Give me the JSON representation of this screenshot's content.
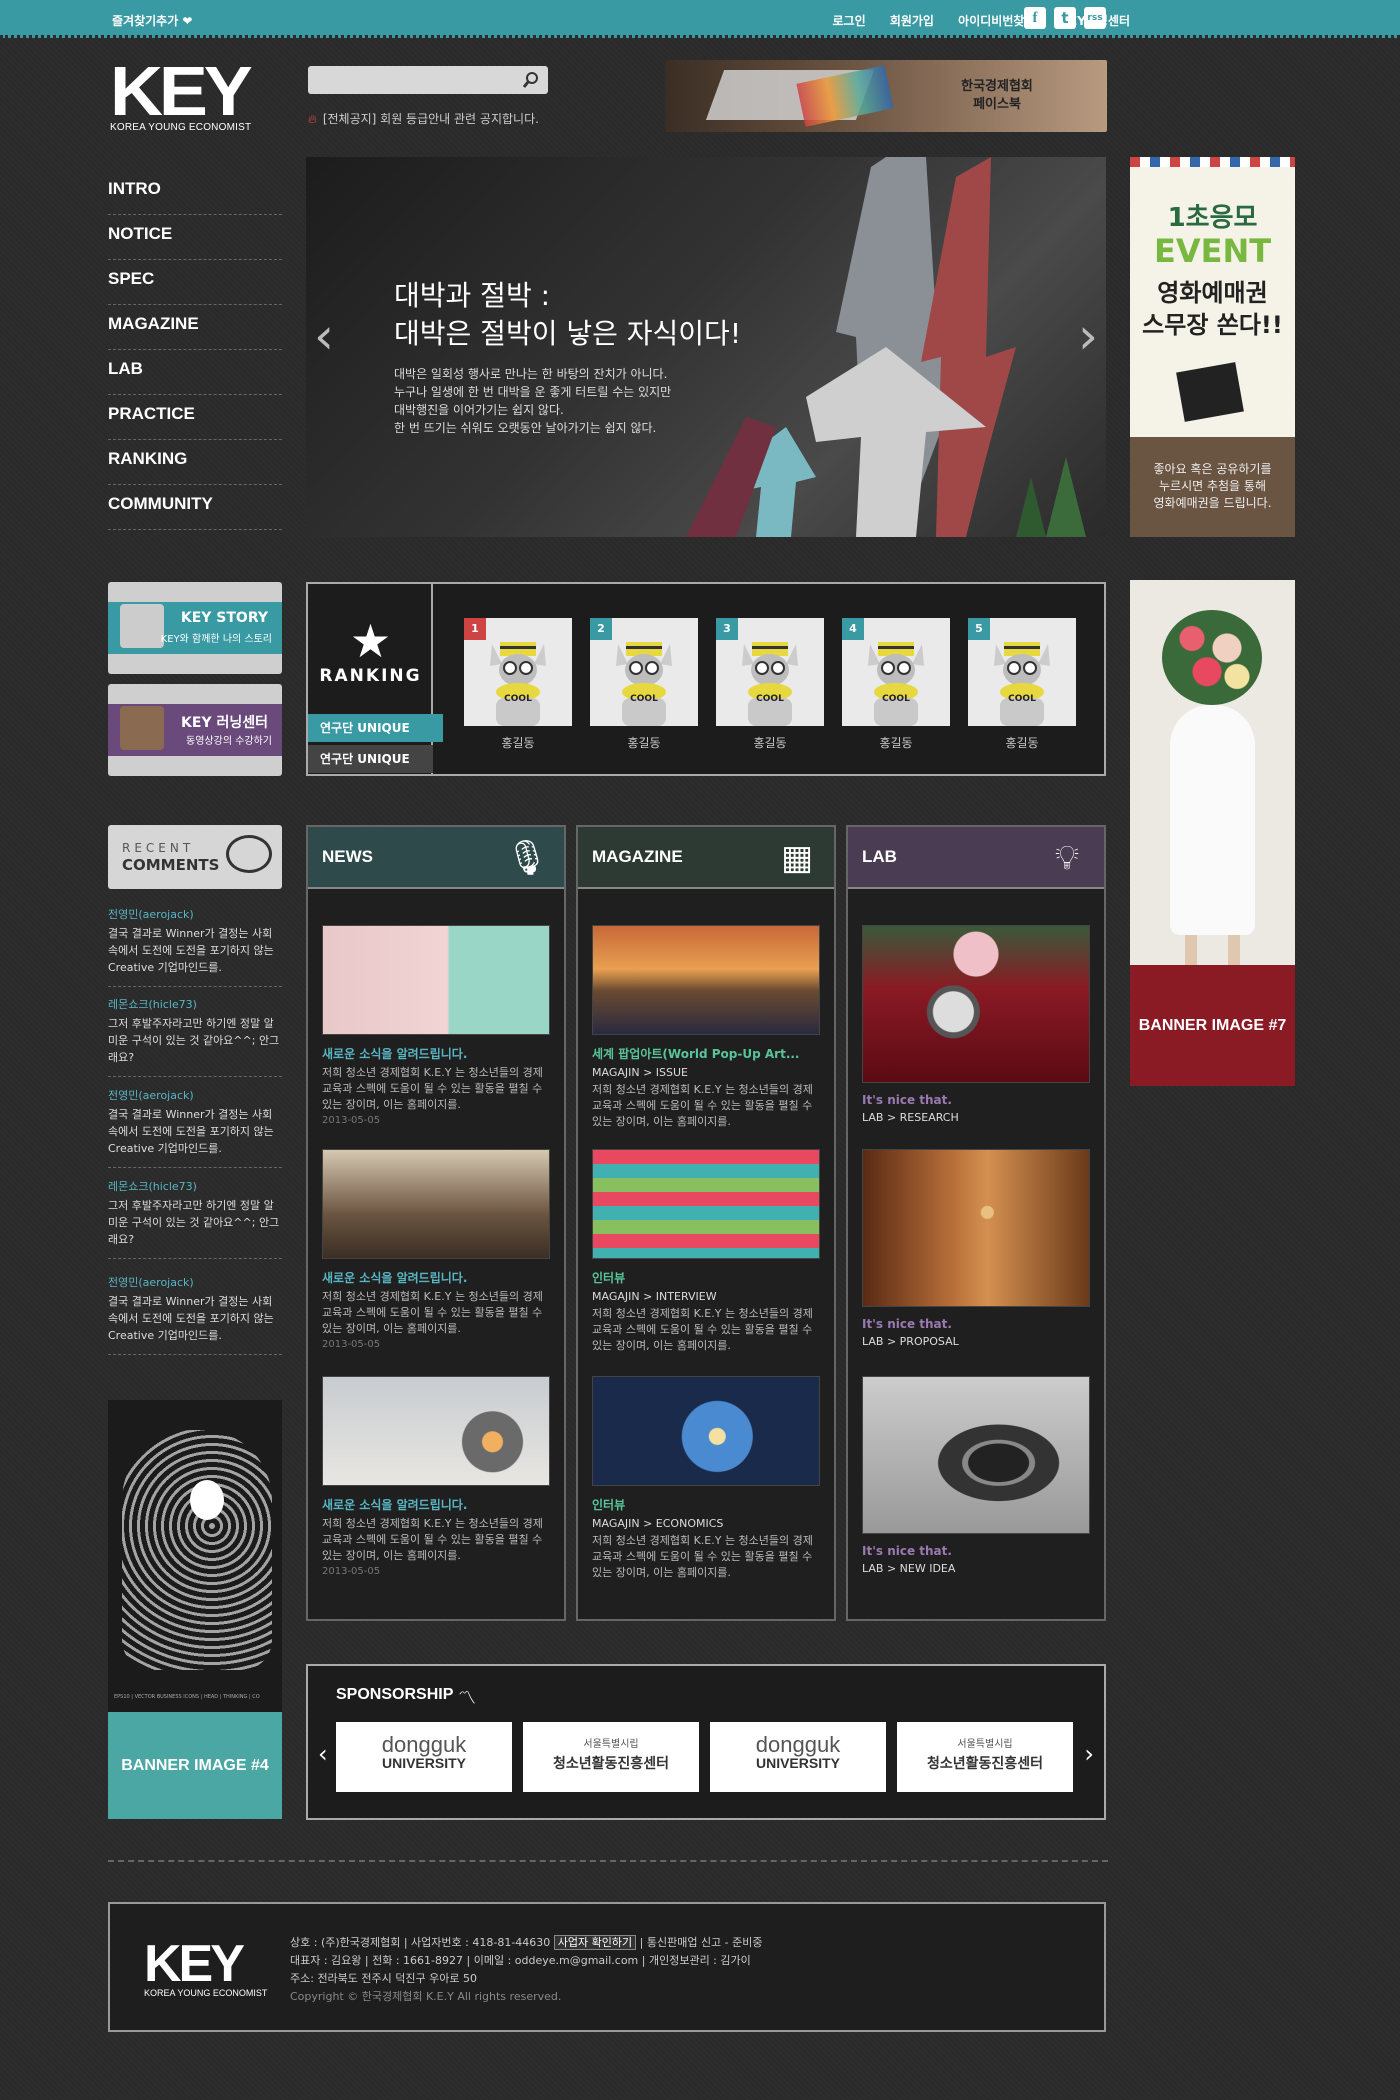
{
  "topbar": {
    "bookmark": "즐겨찾기추가 ❤",
    "links": [
      "로그인",
      "회원가입",
      "아이디비번찾기",
      "KEY러닝센터"
    ],
    "social": [
      "f",
      "t",
      "rss"
    ]
  },
  "brand": {
    "logo": "KEY",
    "tagline": "KOREA YOUNG ECONOMIST"
  },
  "search": {
    "placeholder": ""
  },
  "notice": {
    "text": "[전체공지] 회원 등급안내 관련 공지합니다."
  },
  "fb_banner": {
    "line1": "한국경제협회",
    "line2": "페이스북"
  },
  "nav": [
    "INTRO",
    "NOTICE",
    "SPEC",
    "MAGAZINE",
    "LAB",
    "PRACTICE",
    "RANKING",
    "COMMUNITY"
  ],
  "hero": {
    "title1": "대박과 절박 :",
    "title2": "대박은 절박이 낳은 자식이다!",
    "body": [
      "대박은 일회성 행사로 만나는 한 바탕의 잔치가 아니다.",
      "누구나 일생에 한 번 대박을 운 좋게 터트릴 수는 있지만",
      "대박행진을 이어가기는 쉽지 않다.",
      "한 번 뜨기는 쉬워도 오랫동안 날아가기는 쉽지 않다."
    ],
    "prev": "‹",
    "next": "›"
  },
  "event_banner": {
    "line1": "1초응모",
    "line2": "EVENT",
    "line3": "영화예매권",
    "line4": "스무장 쏜다!!",
    "bottom1": "좋아요 혹은 공유하기를",
    "bottom2": "누르시면 추첨을 통해",
    "bottom3": "영화예매권을 드립니다."
  },
  "key_story": {
    "title": "KEY STORY",
    "sub": "KEY와 함께한 나의 스토리"
  },
  "key_learning": {
    "title": "KEY 러닝센터",
    "sub": "동영상강의 수강하기"
  },
  "ranking": {
    "label": "RANKING",
    "tabs": [
      "연구단 UNIQUE",
      "연구단 UNIQUE"
    ],
    "items": [
      {
        "num": "1",
        "name": "홍길동",
        "badge": "COOL"
      },
      {
        "num": "2",
        "name": "홍길동",
        "badge": "COOL"
      },
      {
        "num": "3",
        "name": "홍길동",
        "badge": "COOL"
      },
      {
        "num": "4",
        "name": "홍길동",
        "badge": "COOL"
      },
      {
        "num": "5",
        "name": "홍길동",
        "badge": "COOL"
      }
    ]
  },
  "recent": {
    "label1": "RECENT",
    "label2": "COMMENTS",
    "items": [
      {
        "who": "전영민(aerojack)",
        "body": "결국 결과로 Winner가 결정는 사회속에서 도전에 도전을 포기하지 않는 Creative 기업마인드를."
      },
      {
        "who": "레몬쇼크(hicle73)",
        "body": "그저 후발주자라고만 하기엔 정말 알 미운 구석이 있는 것 같아요^^; 안그래요?"
      },
      {
        "who": "전영민(aerojack)",
        "body": "결국 결과로 Winner가 결정는 사회속에서 도전에 도전을 포기하지 않는 Creative 기업마인드를."
      },
      {
        "who": "레몬쇼크(hicle73)",
        "body": "그저 후발주자라고만 하기엔 정말 알 미운 구석이 있는 것 같아요^^; 안그래요?"
      },
      {
        "who": "전영민(aerojack)",
        "body": "결국 결과로 Winner가 결정는 사회속에서 도전에 도전을 포기하지 않는 Creative 기업마인드를."
      }
    ]
  },
  "bulb_caption": "EPS10 | VECTOR BUSINESS ICONS | HEAD | THINKING | CO",
  "banner4": "BANNER IMAGE #4",
  "banner7": "BANNER IMAGE #7",
  "news": {
    "title": "NEWS",
    "items": [
      {
        "title": "새로운 소식을 알려드립니다.",
        "desc": "저희 청소년 경제협회 K.E.Y 는 청소년들의 경제교육과 스펙에 도움이 될 수 있는 활동을 펼칠 수 있는 장이며, 이는 홈페이지를.",
        "date": "2013-05-05"
      },
      {
        "title": "새로운 소식을 알려드립니다.",
        "desc": "저희 청소년 경제협회 K.E.Y 는 청소년들의 경제교육과 스펙에 도움이 될 수 있는 활동을 펼칠 수 있는 장이며, 이는 홈페이지를.",
        "date": "2013-05-05"
      },
      {
        "title": "새로운 소식을 알려드립니다.",
        "desc": "저희 청소년 경제협회 K.E.Y 는 청소년들의 경제교육과 스펙에 도움이 될 수 있는 활동을 펼칠 수 있는 장이며, 이는 홈페이지를.",
        "date": "2013-05-05"
      }
    ]
  },
  "magazine": {
    "title": "MAGAZINE",
    "items": [
      {
        "title": "세계 팝업아트(World Pop-Up Art...",
        "cat": "MAGAJIN > ISSUE",
        "desc": "저희 청소년 경제협회 K.E.Y 는 청소년들의 경제교육과 스펙에 도움이 될 수 있는 활동을 펼칠 수 있는 장이며, 이는 홈페이지를."
      },
      {
        "title": "인터뷰",
        "cat": "MAGAJIN > INTERVIEW",
        "desc": "저희 청소년 경제협회 K.E.Y 는 청소년들의 경제교육과 스펙에 도움이 될 수 있는 활동을 펼칠 수 있는 장이며, 이는 홈페이지를."
      },
      {
        "title": "인터뷰",
        "cat": "MAGAJIN > ECONOMICS",
        "desc": "저희 청소년 경제협회 K.E.Y 는 청소년들의 경제교육과 스펙에 도움이 될 수 있는 활동을 펼칠 수 있는 장이며, 이는 홈페이지를."
      }
    ]
  },
  "lab": {
    "title": "LAB",
    "items": [
      {
        "title": "It's nice that.",
        "cat": "LAB > RESEARCH"
      },
      {
        "title": "It's nice that.",
        "cat": "LAB > PROPOSAL"
      },
      {
        "title": "It's nice that.",
        "cat": "LAB > NEW IDEA"
      }
    ]
  },
  "sponsorship": {
    "title": "SPONSORSHIP",
    "logos": [
      {
        "main": "dongguk",
        "sub": "UNIVERSITY"
      },
      {
        "main": "서울특별시립",
        "sub": "청소년활동진흥센터"
      },
      {
        "main": "dongguk",
        "sub": "UNIVERSITY"
      },
      {
        "main": "서울특별시립",
        "sub": "청소년활동진흥센터"
      }
    ],
    "prev": "‹",
    "next": "›"
  },
  "footer": {
    "line1a": "상호 : (주)한국경제협회  |  사업자번호 : 418-81-44630",
    "check_btn": "사업자 확인하기",
    "line1b": "|  통신판매업 신고 - 준비중",
    "line2": "대표자 : 김요왕  |  전화 : 1661-8927  |  이메일 : oddeye.m@gmail.com  |  개인정보관리 : 김가이",
    "line3": "주소: 전라북도 전주시 덕진구 우아로 50",
    "copy": "Copyright © 한국경제협회 K.E.Y   All rights reserved."
  },
  "colors": {
    "teal": "#3a9aa3",
    "purple": "#6a4a7a",
    "news_head": "#2e4a4a",
    "mag_head": "#2d3a34",
    "lab_head": "#4a3c52",
    "banner7": "#8a1a24"
  }
}
